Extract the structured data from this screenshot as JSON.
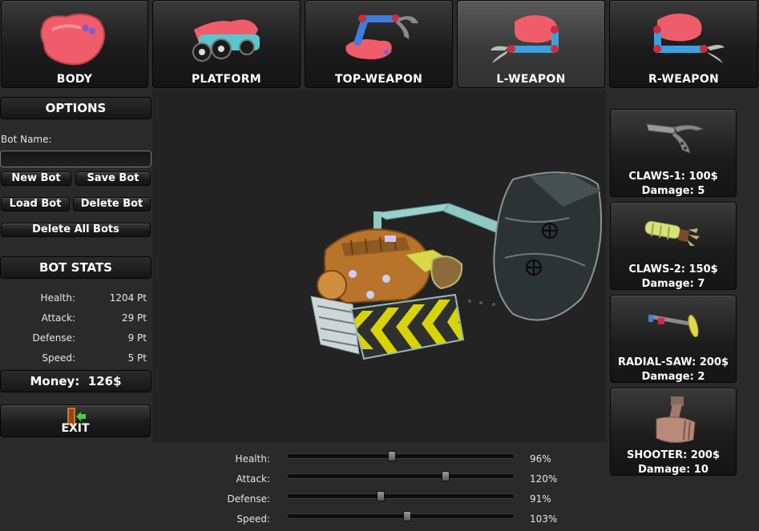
{
  "tabs": [
    {
      "label": "BODY",
      "icon": "body-icon",
      "active": false
    },
    {
      "label": "PLATFORM",
      "icon": "platform-icon",
      "active": false
    },
    {
      "label": "TOP-WEAPON",
      "icon": "top-weapon-icon",
      "active": false
    },
    {
      "label": "L-WEAPON",
      "icon": "left-weapon-icon",
      "active": true
    },
    {
      "label": "R-WEAPON",
      "icon": "right-weapon-icon",
      "active": false
    }
  ],
  "options": {
    "title": "OPTIONS",
    "bot_name_label": "Bot Name:",
    "bot_name_value": "",
    "new_bot": "New Bot",
    "save_bot": "Save Bot",
    "load_bot": "Load Bot",
    "delete_bot": "Delete Bot",
    "delete_all": "Delete All Bots"
  },
  "stats": {
    "title": "BOT STATS",
    "rows": [
      {
        "label": "Health:",
        "value": "1204 Pt"
      },
      {
        "label": "Attack:",
        "value": "29 Pt"
      },
      {
        "label": "Defense:",
        "value": "9 Pt"
      },
      {
        "label": "Speed:",
        "value": "5 Pt"
      }
    ]
  },
  "money": "Money:  126$",
  "exit": {
    "label": "EXIT",
    "icon": "exit-door-icon"
  },
  "weapons": [
    {
      "name": "CLAWS-1: 100$",
      "damage": "Damage: 5",
      "icon": "claws-1-icon"
    },
    {
      "name": "CLAWS-2: 150$",
      "damage": "Damage: 7",
      "icon": "claws-2-icon"
    },
    {
      "name": "RADIAL-SAW: 200$",
      "damage": "Damage: 2",
      "icon": "radial-saw-icon"
    },
    {
      "name": "SHOOTER: 200$",
      "damage": "Damage: 10",
      "icon": "shooter-icon"
    }
  ],
  "sliders": [
    {
      "label": "Health:",
      "value": "96%",
      "level": 0.46
    },
    {
      "label": "Attack:",
      "value": "120%",
      "level": 0.7
    },
    {
      "label": "Defense:",
      "value": "91%",
      "level": 0.41
    },
    {
      "label": "Speed:",
      "value": "103%",
      "level": 0.53
    }
  ],
  "colors": {
    "background": "#2a2a2a",
    "viewport": "#232323",
    "body_part": "#ef5d6a",
    "hazard_yellow": "#d8d400",
    "arm_cyan": "#8fc9c3"
  }
}
